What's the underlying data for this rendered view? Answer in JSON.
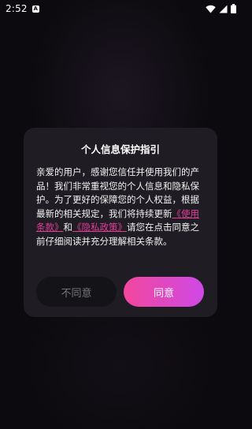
{
  "status_bar": {
    "time": "2:52",
    "notification_icon": "A",
    "icons": [
      "wifi-icon",
      "signal-icon",
      "battery-icon"
    ]
  },
  "dialog": {
    "title": "个人信息保护指引",
    "body_part1": "亲爱的用户，感谢您信任并使用我们的产品！我们非常重视您的个人信息和隐私保护。为了更好的保障您的个人权益，根据最新的相关规定，我们将持续更新",
    "terms_link": "《使用条款》",
    "and_text": "和",
    "privacy_link": "《隐私政策》",
    "body_part2": "请您在点击同意之前仔细阅读并充分理解相关条款。",
    "disagree_label": "不同意",
    "agree_label": "同意"
  },
  "colors": {
    "background": "#0c0a0e",
    "dialog_bg": "#1f1d23",
    "link": "#e33d98",
    "agree_gradient_start": "#f1479d",
    "agree_gradient_end": "#cf49e6",
    "disagree_bg": "#141317",
    "disagree_text": "#77757b"
  }
}
